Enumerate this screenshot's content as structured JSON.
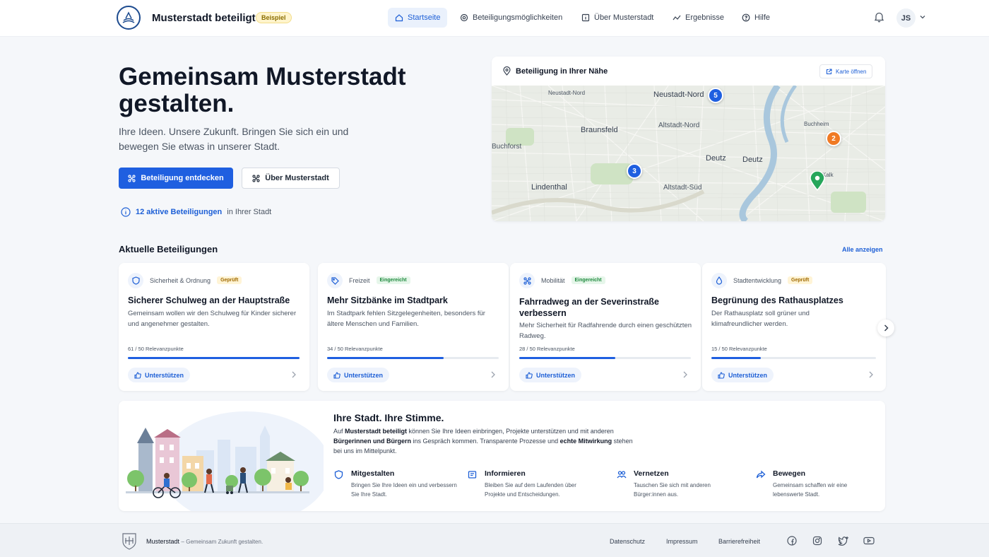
{
  "header": {
    "brand": "Musterstadt beteiligt",
    "badge": "Beispiel",
    "nav": [
      {
        "label": "Startseite",
        "icon": "home-icon",
        "active": true
      },
      {
        "label": "Beteiligungsmöglichkeiten",
        "icon": "target-icon"
      },
      {
        "label": "Über Musterstadt",
        "icon": "info-box-icon"
      },
      {
        "label": "Ergebnisse",
        "icon": "chart-line-icon"
      },
      {
        "label": "Hilfe",
        "icon": "help-circle-icon"
      }
    ],
    "user_initials": "JS"
  },
  "hero": {
    "title": "Gemeinsam Musterstadt gestalten.",
    "subtitle": "Ihre Ideen. Unsere Zukunft. Bringen Sie sich ein und bewegen Sie etwas in unserer Stadt.",
    "primary_button": "Beteiligung entdecken",
    "secondary_button": "Über Musterstadt",
    "active_count_link": "12 aktive Beteiligungen",
    "active_count_suffix": "in Ihrer Stadt"
  },
  "map": {
    "title": "Beteiligung in Ihrer Nähe",
    "open_button": "Karte öffnen",
    "labels": [
      "Neustadt-Nord",
      "Neustadt-Nord",
      "Braunsfeld",
      "Altstadt-Nord",
      "Buchforst",
      "Deutz",
      "Deutz",
      "Lindenthal",
      "Altstadt-Süd",
      "Buchheim",
      "Kalk"
    ],
    "pins": [
      {
        "label": "5",
        "color": "#1f5fe0"
      },
      {
        "label": "3",
        "color": "#1f5fe0"
      },
      {
        "label": "2",
        "color": "#f07a24"
      },
      {
        "label": "",
        "color": "#26a65b"
      }
    ]
  },
  "section": {
    "title": "Aktuelle Beteiligungen",
    "see_all": "Alle anzeigen"
  },
  "cards": [
    {
      "category": "Sicherheit & Ordnung",
      "status": "Geprüft",
      "icon": "shield-icon",
      "title": "Sicherer Schulweg an der Hauptstraße",
      "description": "Gemeinsam wollen wir den Schulweg für Kinder sicherer und angenehmer gestalten.",
      "points": "61 / 50 Relevanzpunkte",
      "progress": 1.0,
      "support": "Unterstützen"
    },
    {
      "category": "Freizeit",
      "status": "Eingereicht",
      "icon": "tag-icon",
      "title": "Mehr Sitzbänke im Stadtpark",
      "description": "Im Stadtpark fehlen Sitzgelegenheiten, besonders für ältere Menschen und Familien.",
      "points": "34 / 50 Relevanzpunkte",
      "progress": 0.68,
      "support": "Unterstützen"
    },
    {
      "category": "Mobilität",
      "status": "Eingereicht",
      "icon": "nodes-icon",
      "title": "Fahrradweg an der Severinstraße verbessern",
      "description": "Mehr Sicherheit für Radfahrende durch einen geschützten Radweg.",
      "points": "28 / 50 Relevanzpunkte",
      "progress": 0.56,
      "support": "Unterstützen"
    },
    {
      "category": "Stadtentwicklung",
      "status": "Geprüft",
      "icon": "drop-icon",
      "title": "Begrünung des Rathausplatzes",
      "description": "Der Rathausplatz soll grüner und klimafreundlicher werden.",
      "points": "15 / 50 Relevanzpunkte",
      "progress": 0.3,
      "support": "Unterstützen"
    }
  ],
  "info": {
    "title": "Ihre Stadt. Ihre Stimme.",
    "text_parts": [
      "Auf ",
      "Musterstadt beteiligt",
      " können Sie Ihre Ideen einbringen, Projekte unterstützen und mit anderen ",
      "Bürgerinnen und Bürgern",
      " ins Gespräch kommen. Transparente Prozesse und ",
      "echte Mitwirkung",
      " stehen bei uns im Mittelpunkt."
    ],
    "features": [
      {
        "title": "Mitgestalten",
        "text": "Bringen Sie Ihre Ideen ein und verbessern Sie Ihre Stadt.",
        "icon": "shield-icon"
      },
      {
        "title": "Informieren",
        "text": "Bleiben Sie auf dem Laufenden über Projekte und Entscheidungen.",
        "icon": "document-icon"
      },
      {
        "title": "Vernetzen",
        "text": "Tauschen Sie sich mit anderen Bürger:innen aus.",
        "icon": "people-icon"
      },
      {
        "title": "Bewegen",
        "text": "Gemeinsam schaffen wir eine lebenswerte Stadt.",
        "icon": "share-arrow-icon"
      }
    ]
  },
  "footer": {
    "brand": "Musterstadt",
    "tagline": "– Gemeinsam Zukunft gestalten.",
    "links": [
      "Datenschutz",
      "Impressum",
      "Barrierefreiheit"
    ],
    "social": [
      "facebook-icon",
      "instagram-icon",
      "twitter-icon",
      "youtube-icon"
    ]
  },
  "colors": {
    "primary": "#1f5fe0",
    "orange_pin": "#f07a24",
    "green_pin": "#26a65b",
    "page_bg": "#f5f7fa"
  }
}
